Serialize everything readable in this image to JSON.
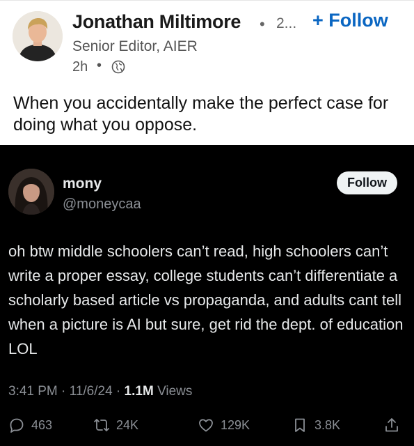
{
  "linkedin": {
    "author": "Jonathan Miltimore",
    "degree": "2...",
    "follow_label": "+ Follow",
    "headline": "Senior Editor, AIER",
    "time": "2h",
    "post_text": "When you accidentally make the perfect case for doing what you oppose."
  },
  "tweet": {
    "name": "mony",
    "handle": "@moneycaa",
    "follow_label": "Follow",
    "text": "oh btw middle schoolers can’t read, high schoolers can’t write a proper essay, college students can’t differentiate a scholarly based article vs propaganda, and adults cant tell when a picture is AI but sure, get rid the dept. of education LOL",
    "time": "3:41 PM",
    "date": "11/6/24",
    "views_count": "1.1M",
    "views_label": "Views",
    "actions": {
      "replies": "463",
      "reposts": "24K",
      "likes": "129K",
      "bookmarks": "3.8K"
    }
  },
  "icons": [
    "globe-icon",
    "reply-icon",
    "repost-icon",
    "like-icon",
    "bookmark-icon",
    "share-icon"
  ],
  "colors": {
    "linkedin_blue": "#0a66c2",
    "x_background": "#000000",
    "x_muted": "#8b8f95"
  }
}
